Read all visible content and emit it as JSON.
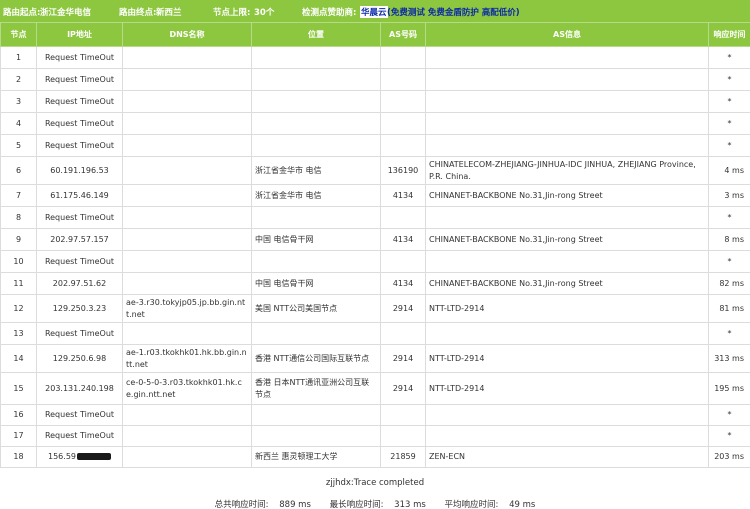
{
  "header": {
    "origin_label": "路由起点:",
    "origin_value": "浙江金华电信",
    "dest_label": "路由终点:",
    "dest_value": "新西兰",
    "nodes_label": "节点上限:",
    "nodes_value": "30个",
    "sponsor_label": "检测点赞助商:",
    "sponsor_name": "华晨云",
    "sponsor_links": "(免费测试 免费金盾防护 高配低价)"
  },
  "columns": [
    "节点",
    "IP地址",
    "DNS名称",
    "位置",
    "AS号码",
    "AS信息",
    "响应时间"
  ],
  "rows": [
    {
      "hop": "1",
      "ip": "Request TimeOut",
      "dns": "",
      "loc": "",
      "as": "",
      "asinfo": "",
      "time": "*"
    },
    {
      "hop": "2",
      "ip": "Request TimeOut",
      "dns": "",
      "loc": "",
      "as": "",
      "asinfo": "",
      "time": "*"
    },
    {
      "hop": "3",
      "ip": "Request TimeOut",
      "dns": "",
      "loc": "",
      "as": "",
      "asinfo": "",
      "time": "*"
    },
    {
      "hop": "4",
      "ip": "Request TimeOut",
      "dns": "",
      "loc": "",
      "as": "",
      "asinfo": "",
      "time": "*"
    },
    {
      "hop": "5",
      "ip": "Request TimeOut",
      "dns": "",
      "loc": "",
      "as": "",
      "asinfo": "",
      "time": "*"
    },
    {
      "hop": "6",
      "ip": "60.191.196.53",
      "dns": "",
      "loc": "浙江省金华市 电信",
      "as": "136190",
      "asinfo": "CHINATELECOM-ZHEJIANG-JINHUA-IDC JINHUA, ZHEJIANG Province, P.R. China.",
      "time": "4 ms"
    },
    {
      "hop": "7",
      "ip": "61.175.46.149",
      "dns": "",
      "loc": "浙江省金华市 电信",
      "as": "4134",
      "asinfo": "CHINANET-BACKBONE No.31,Jin-rong Street",
      "time": "3 ms"
    },
    {
      "hop": "8",
      "ip": "Request TimeOut",
      "dns": "",
      "loc": "",
      "as": "",
      "asinfo": "",
      "time": "*"
    },
    {
      "hop": "9",
      "ip": "202.97.57.157",
      "dns": "",
      "loc": "中国 电信骨干网",
      "as": "4134",
      "asinfo": "CHINANET-BACKBONE No.31,Jin-rong Street",
      "time": "8 ms"
    },
    {
      "hop": "10",
      "ip": "Request TimeOut",
      "dns": "",
      "loc": "",
      "as": "",
      "asinfo": "",
      "time": "*"
    },
    {
      "hop": "11",
      "ip": "202.97.51.62",
      "dns": "",
      "loc": "中国 电信骨干网",
      "as": "4134",
      "asinfo": "CHINANET-BACKBONE No.31,Jin-rong Street",
      "time": "82 ms"
    },
    {
      "hop": "12",
      "ip": "129.250.3.23",
      "dns": "ae-3.r30.tokyjp05.jp.bb.gin.ntt.net",
      "loc": "美国 NTT公司美国节点",
      "as": "2914",
      "asinfo": "NTT-LTD-2914",
      "time": "81 ms"
    },
    {
      "hop": "13",
      "ip": "Request TimeOut",
      "dns": "",
      "loc": "",
      "as": "",
      "asinfo": "",
      "time": "*"
    },
    {
      "hop": "14",
      "ip": "129.250.6.98",
      "dns": "ae-1.r03.tkokhk01.hk.bb.gin.ntt.net",
      "loc": "香港 NTT通信公司国际互联节点",
      "as": "2914",
      "asinfo": "NTT-LTD-2914",
      "time": "313 ms"
    },
    {
      "hop": "15",
      "ip": "203.131.240.198",
      "dns": "ce-0-5-0-3.r03.tkokhk01.hk.ce.gin.ntt.net",
      "loc": "香港 日本NTT通讯亚洲公司互联节点",
      "as": "2914",
      "asinfo": "NTT-LTD-2914",
      "time": "195 ms"
    },
    {
      "hop": "16",
      "ip": "Request TimeOut",
      "dns": "",
      "loc": "",
      "as": "",
      "asinfo": "",
      "time": "*"
    },
    {
      "hop": "17",
      "ip": "Request TimeOut",
      "dns": "",
      "loc": "",
      "as": "",
      "asinfo": "",
      "time": "*"
    },
    {
      "hop": "18",
      "ip": "156.59",
      "dns": "",
      "loc": "新西兰 惠灵顿理工大学",
      "as": "21859",
      "asinfo": "ZEN-ECN",
      "time": "203 ms"
    }
  ],
  "footer": {
    "status": "zjjhdx:Trace completed",
    "total_label": "总共响应时间:",
    "total_value": "889 ms",
    "max_label": "最长响应时间:",
    "max_value": "313 ms",
    "avg_label": "平均响应时间:",
    "avg_value": "49 ms"
  }
}
